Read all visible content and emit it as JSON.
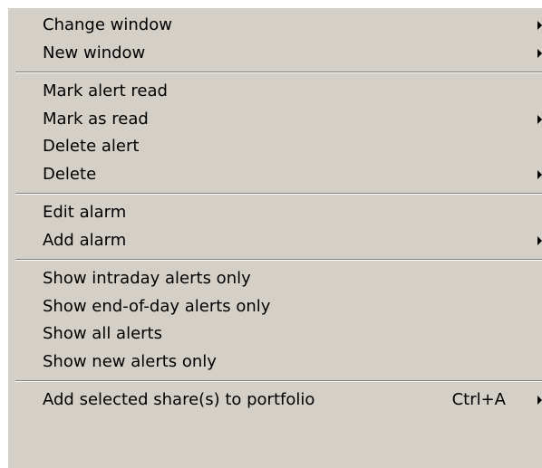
{
  "menu": {
    "groups": [
      {
        "items": [
          {
            "label": "Change window",
            "submenu": true
          },
          {
            "label": "New window",
            "submenu": true
          }
        ]
      },
      {
        "items": [
          {
            "label": "Mark alert read",
            "submenu": false
          },
          {
            "label": "Mark as read",
            "submenu": true
          },
          {
            "label": "Delete alert",
            "submenu": false
          },
          {
            "label": "Delete",
            "submenu": true
          }
        ]
      },
      {
        "items": [
          {
            "label": "Edit alarm",
            "submenu": false
          },
          {
            "label": "Add alarm",
            "submenu": true
          }
        ]
      },
      {
        "items": [
          {
            "label": "Show intraday alerts only",
            "submenu": false
          },
          {
            "label": "Show end-of-day alerts only",
            "submenu": false
          },
          {
            "label": "Show all alerts",
            "submenu": false
          },
          {
            "label": "Show new alerts only",
            "submenu": false
          }
        ]
      },
      {
        "items": [
          {
            "label": "Add selected share(s) to portfolio",
            "shortcut": "Ctrl+A",
            "submenu": true
          }
        ]
      }
    ]
  },
  "colors": {
    "menu_background": "#d4d0c8",
    "separator_dark": "#808080",
    "separator_light": "#ffffff",
    "text": "#000000"
  },
  "icons": {
    "submenu": "submenu-arrow-icon"
  }
}
